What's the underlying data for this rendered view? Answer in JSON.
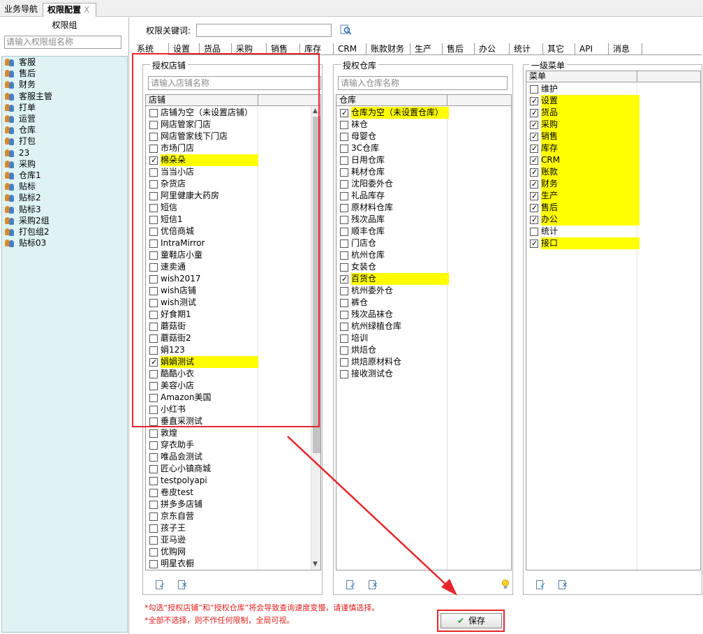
{
  "top_tabs": {
    "nav": "业务导航",
    "active": "权限配置",
    "close": "X"
  },
  "left": {
    "title": "权限组",
    "search_placeholder": "请输入权限组名称",
    "groups": [
      "客服",
      "售后",
      "财务",
      "客服主管",
      "打单",
      "运营",
      "仓库",
      "打包",
      "23",
      "采购",
      "仓库1",
      "贴标",
      "贴标2",
      "贴标3",
      "采购2组",
      "打包组2",
      "贴标03"
    ]
  },
  "keyword": {
    "label": "权限关键词:",
    "value": ""
  },
  "module_tabs": [
    "系统",
    "设置",
    "货品",
    "采购",
    "销售",
    "库存",
    "CRM",
    "账款财务",
    "生产",
    "售后",
    "办公",
    "统计",
    "其它",
    "API",
    "消息"
  ],
  "stores": {
    "legend": "授权店铺",
    "search_placeholder": "请输入店铺名称",
    "header": "店铺",
    "items": [
      {
        "label": "店铺为空（未设置店铺）",
        "checked": false,
        "hl": false
      },
      {
        "label": "网店管家门店",
        "checked": false,
        "hl": false
      },
      {
        "label": "网店管家线下门店",
        "checked": false,
        "hl": false
      },
      {
        "label": "市场门店",
        "checked": false,
        "hl": false
      },
      {
        "label": "棉朵朵",
        "checked": true,
        "hl": true
      },
      {
        "label": "当当小店",
        "checked": false,
        "hl": false
      },
      {
        "label": "杂货店",
        "checked": false,
        "hl": false
      },
      {
        "label": "阿里健康大药房",
        "checked": false,
        "hl": false
      },
      {
        "label": "短信",
        "checked": false,
        "hl": false
      },
      {
        "label": "短信1",
        "checked": false,
        "hl": false
      },
      {
        "label": "优倍商城",
        "checked": false,
        "hl": false
      },
      {
        "label": "IntraMirror",
        "checked": false,
        "hl": false
      },
      {
        "label": "童鞋店小童",
        "checked": false,
        "hl": false
      },
      {
        "label": "速卖通",
        "checked": false,
        "hl": false
      },
      {
        "label": "wish2017",
        "checked": false,
        "hl": false
      },
      {
        "label": "wish店铺",
        "checked": false,
        "hl": false
      },
      {
        "label": "wish测试",
        "checked": false,
        "hl": false
      },
      {
        "label": "好食期1",
        "checked": false,
        "hl": false
      },
      {
        "label": "蘑菇街",
        "checked": false,
        "hl": false
      },
      {
        "label": "蘑菇街2",
        "checked": false,
        "hl": false
      },
      {
        "label": "娟123",
        "checked": false,
        "hl": false
      },
      {
        "label": "娟娟测试",
        "checked": true,
        "hl": true
      },
      {
        "label": "酷酷小衣",
        "checked": false,
        "hl": false
      },
      {
        "label": "美容小店",
        "checked": false,
        "hl": false
      },
      {
        "label": "Amazon美国",
        "checked": false,
        "hl": false
      },
      {
        "label": "小红书",
        "checked": false,
        "hl": false
      },
      {
        "label": "垂直采测试",
        "checked": false,
        "hl": false
      },
      {
        "label": "敦煌",
        "checked": false,
        "hl": false
      },
      {
        "label": "穿衣助手",
        "checked": false,
        "hl": false
      },
      {
        "label": "唯品会测试",
        "checked": false,
        "hl": false
      },
      {
        "label": "匠心小镇商城",
        "checked": false,
        "hl": false
      },
      {
        "label": "testpolyapi",
        "checked": false,
        "hl": false
      },
      {
        "label": "卷皮test",
        "checked": false,
        "hl": false
      },
      {
        "label": "拼多多店铺",
        "checked": false,
        "hl": false
      },
      {
        "label": "京东自营",
        "checked": false,
        "hl": false
      },
      {
        "label": "孩子王",
        "checked": false,
        "hl": false
      },
      {
        "label": "亚马逊",
        "checked": false,
        "hl": false
      },
      {
        "label": "优购网",
        "checked": false,
        "hl": false
      },
      {
        "label": "明星衣橱",
        "checked": false,
        "hl": false
      }
    ]
  },
  "warehouses": {
    "legend": "授权仓库",
    "search_placeholder": "请输入仓库名称",
    "header": "仓库",
    "items": [
      {
        "label": "仓库为空（未设置仓库）",
        "checked": true,
        "hl": true
      },
      {
        "label": "袜仓",
        "checked": false,
        "hl": false
      },
      {
        "label": "母婴仓",
        "checked": false,
        "hl": false
      },
      {
        "label": "3C仓库",
        "checked": false,
        "hl": false
      },
      {
        "label": "日用仓库",
        "checked": false,
        "hl": false
      },
      {
        "label": "耗材仓库",
        "checked": false,
        "hl": false
      },
      {
        "label": "沈阳委外仓",
        "checked": false,
        "hl": false
      },
      {
        "label": "礼品库存",
        "checked": false,
        "hl": false
      },
      {
        "label": "原材料仓库",
        "checked": false,
        "hl": false
      },
      {
        "label": "残次品库",
        "checked": false,
        "hl": false
      },
      {
        "label": "顺丰仓库",
        "checked": false,
        "hl": false
      },
      {
        "label": "门店仓",
        "checked": false,
        "hl": false
      },
      {
        "label": "杭州仓库",
        "checked": false,
        "hl": false
      },
      {
        "label": "女装仓",
        "checked": false,
        "hl": false
      },
      {
        "label": "百货仓",
        "checked": true,
        "hl": true
      },
      {
        "label": "杭州委外仓",
        "checked": false,
        "hl": false
      },
      {
        "label": "裤仓",
        "checked": false,
        "hl": false
      },
      {
        "label": "残次品袜仓",
        "checked": false,
        "hl": false
      },
      {
        "label": "杭州绿植仓库",
        "checked": false,
        "hl": false
      },
      {
        "label": "培训",
        "checked": false,
        "hl": false
      },
      {
        "label": "烘焙仓",
        "checked": false,
        "hl": false
      },
      {
        "label": "烘焙原材料仓",
        "checked": false,
        "hl": false
      },
      {
        "label": "接收测试仓",
        "checked": false,
        "hl": false
      }
    ]
  },
  "menus": {
    "legend": "一级菜单",
    "header": "菜单",
    "items": [
      {
        "label": "维护",
        "checked": false,
        "hl": false
      },
      {
        "label": "设置",
        "checked": true,
        "hl": true
      },
      {
        "label": "货品",
        "checked": true,
        "hl": true
      },
      {
        "label": "采购",
        "checked": true,
        "hl": true
      },
      {
        "label": "销售",
        "checked": true,
        "hl": true
      },
      {
        "label": "库存",
        "checked": true,
        "hl": true
      },
      {
        "label": "CRM",
        "checked": true,
        "hl": true
      },
      {
        "label": "账款",
        "checked": true,
        "hl": true
      },
      {
        "label": "财务",
        "checked": true,
        "hl": true
      },
      {
        "label": "生产",
        "checked": true,
        "hl": true
      },
      {
        "label": "售后",
        "checked": true,
        "hl": true
      },
      {
        "label": "办公",
        "checked": true,
        "hl": true
      },
      {
        "label": "统计",
        "checked": false,
        "hl": false
      },
      {
        "label": "接口",
        "checked": true,
        "hl": true
      }
    ]
  },
  "notes": [
    "*勾选“授权店铺”和“授权仓库”将会导致查询速度变慢，请谨慎选择。",
    "*全部不选择，则不作任何限制，全局可视。"
  ],
  "save_label": "保存",
  "colors": {
    "highlight": "#ffff00",
    "annotation": "#e8262a",
    "group_bg": "#dff3f5"
  },
  "icons": [
    "group-icon",
    "search-icon",
    "select-all-icon",
    "clear-icon",
    "lightbulb-icon",
    "check-icon",
    "arrow-annotation"
  ]
}
